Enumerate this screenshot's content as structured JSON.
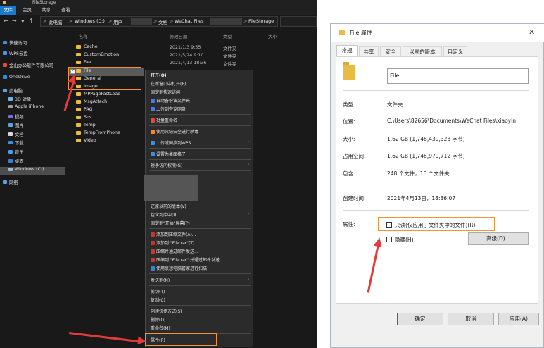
{
  "explorer": {
    "title": "FileStorage",
    "ribbon_tabs": [
      "文件",
      "主页",
      "共享",
      "查看"
    ],
    "address": {
      "seg1": "此电脑",
      "seg2": "Windows (C:)",
      "seg3": "用户",
      "seg4": "文档",
      "seg5": "WeChat Files",
      "seg6": "FileStorage"
    },
    "nav_items": [
      "快速访问",
      "WPS云盘",
      "金山办公软件有限公司",
      "OneDrive",
      "此电脑",
      "3D 对象",
      "Apple iPhone",
      "视频",
      "图片",
      "文档",
      "下载",
      "音乐",
      "桌面",
      "Windows (C:)",
      "网络"
    ],
    "columns": {
      "name": "名称",
      "date": "修改日期",
      "type": "类型",
      "size": "大小"
    },
    "rows": [
      {
        "name": "Cache",
        "date": "2021/1/3 9:55",
        "type": "文件夹"
      },
      {
        "name": "CustomEmotion",
        "date": "2021/5/24 9:10",
        "type": "文件夹"
      },
      {
        "name": "Fav",
        "date": "2021/4/13 18:36",
        "type": "文件夹"
      },
      {
        "name": "File",
        "date": "",
        "type": ""
      },
      {
        "name": "General",
        "date": "",
        "type": ""
      },
      {
        "name": "Image",
        "date": "",
        "type": ""
      },
      {
        "name": "MPPageFastLoad",
        "date": "",
        "type": ""
      },
      {
        "name": "MsgAttach",
        "date": "",
        "type": ""
      },
      {
        "name": "PAG",
        "date": "",
        "type": ""
      },
      {
        "name": "Sns",
        "date": "",
        "type": ""
      },
      {
        "name": "Temp",
        "date": "",
        "type": ""
      },
      {
        "name": "TempFromPhone",
        "date": "",
        "type": ""
      },
      {
        "name": "Video",
        "date": "",
        "type": ""
      }
    ],
    "context_menu": [
      "打开(O)",
      "在新窗口中打开(E)",
      "固定到快速访问",
      "自动备份该文件夹",
      "上传到夸克网盘",
      "批量重命名",
      "使用火绒安全进行杀毒",
      "上传或同步到WPS",
      "设置为桌面格子",
      "授予访问权限(G)",
      "还原以前的版本(V)",
      "包含到库中(I)",
      "固定到\"开始\"屏幕(P)",
      "添加到压缩文件(A)...",
      "添加到 \"File.rar\"(T)",
      "压缩并通过邮件发送...",
      "压缩到 \"File.rar\" 并通过邮件发送",
      "使用联想电脑管家进行扫描",
      "发送到(N)",
      "剪切(T)",
      "复制(C)",
      "创建快捷方式(S)",
      "删除(D)",
      "重命名(M)",
      "属性(R)"
    ]
  },
  "dialog": {
    "title": "File 属性",
    "tabs": [
      "常规",
      "共享",
      "安全",
      "以前的版本",
      "自定义"
    ],
    "name_value": "File",
    "fields": {
      "type_label": "类型:",
      "type_value": "文件夹",
      "location_label": "位置:",
      "location_value": "C:\\Users\\82656\\Documents\\WeChat Files\\xiaoyin",
      "size_label": "大小:",
      "size_value": "1.62 GB (1,748,439,323 字节)",
      "disk_label": "占用空间:",
      "disk_value": "1.62 GB (1,748,979,712 字节)",
      "contains_label": "包含:",
      "contains_value": "248 个文件，16 个文件夹",
      "created_label": "创建时间:",
      "created_value": "2021年4月13日，18:36:07",
      "attr_label": "属性:"
    },
    "readonly_label": "只读(仅应用于文件夹中的文件)(R)",
    "hidden_label": "隐藏(H)",
    "advanced_label": "高级(D)...",
    "ok_label": "确定",
    "cancel_label": "取消",
    "apply_label": "应用(A)"
  },
  "colors": {
    "accent_blue": "#1979ca",
    "highlight_orange": "#f0943b",
    "arrow_red": "#e23b3b",
    "folder_yellow": "#e9bb45"
  }
}
